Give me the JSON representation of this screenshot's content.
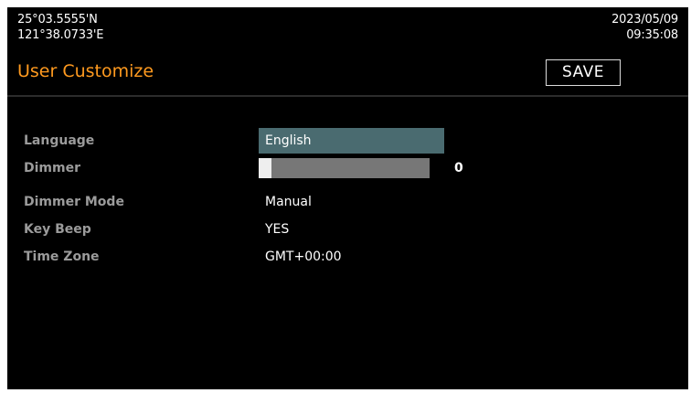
{
  "status": {
    "latitude": "25°03.5555'N",
    "longitude": "121°38.0733'E",
    "date": "2023/05/09",
    "time": "09:35:08"
  },
  "header": {
    "title": "User Customize",
    "save_label": "SAVE"
  },
  "settings": {
    "language": {
      "label": "Language",
      "value": "English"
    },
    "dimmer": {
      "label": "Dimmer",
      "value": "0",
      "level": 0
    },
    "dimmer_mode": {
      "label": "Dimmer Mode",
      "value": "Manual"
    },
    "key_beep": {
      "label": "Key Beep",
      "value": "YES"
    },
    "time_zone": {
      "label": "Time Zone",
      "value": "GMT+00:00"
    }
  },
  "colors": {
    "background": "#000000",
    "title": "#ff9a1f",
    "label": "#9b9b9b",
    "value": "#ffffff",
    "selected": "#4a6b70",
    "slider_track": "#777777",
    "slider_thumb": "#eeeeee"
  }
}
